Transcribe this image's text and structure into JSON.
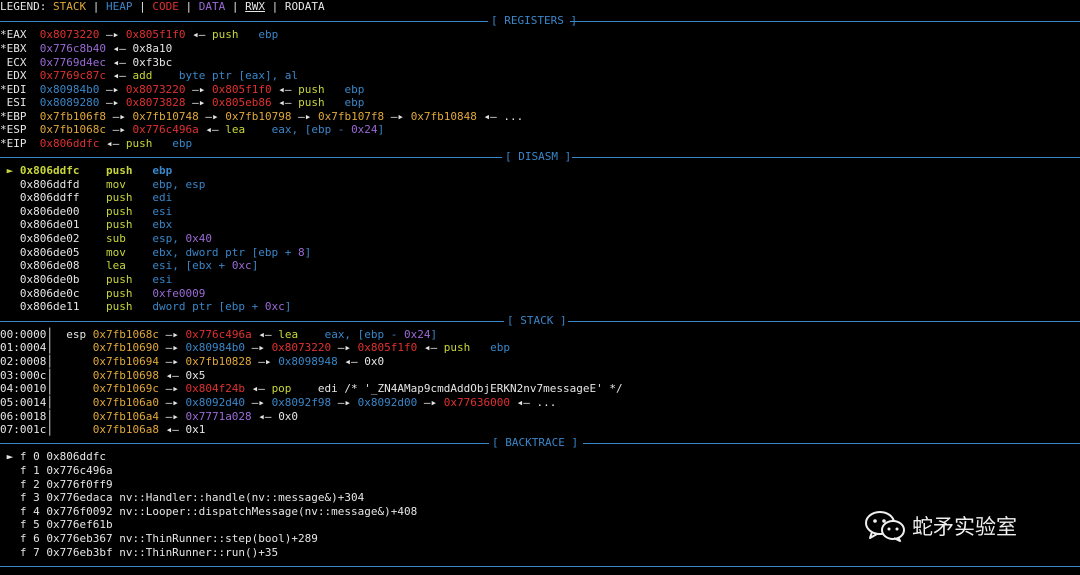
{
  "colors": {
    "stack": "#e0a83a",
    "heap": "#3a86c8",
    "code": "#e03030",
    "data": "#9a6ad6",
    "plain": "#e6e6e6",
    "asm": "#c8d63a",
    "sep": "#3a86c8",
    "arrow": "#e6e6e6"
  },
  "sections": {
    "registers": "[ REGISTERS ]",
    "disasm": "[ DISASM ]",
    "stack": "[ STACK ]",
    "backtrace": "[ BACKTRACE ]"
  },
  "watermark": "蛇矛实验室",
  "lines": [
    {
      "id": "legend",
      "segs": [
        [
          "LEGEND: ",
          "plain"
        ],
        [
          "STACK",
          "stack"
        ],
        [
          " | ",
          "plain"
        ],
        [
          "HEAP",
          "heap"
        ],
        [
          " | ",
          "plain"
        ],
        [
          "CODE",
          "code"
        ],
        [
          " | ",
          "plain"
        ],
        [
          "DATA",
          "data"
        ],
        [
          " | ",
          "plain"
        ],
        [
          "RWX",
          "plain"
        ],
        [
          " | ",
          "plain"
        ],
        [
          "RODATA",
          "plain"
        ]
      ]
    },
    {
      "id": "reg-eax",
      "segs": [
        [
          "*EAX  ",
          "plain"
        ],
        [
          "0x8073220",
          "code"
        ],
        [
          " —▸ ",
          "arrow"
        ],
        [
          "0x805f1f0",
          "code"
        ],
        [
          " ◂— ",
          "arrow"
        ],
        [
          "push",
          "asm"
        ],
        [
          "   ebp",
          "heap"
        ]
      ]
    },
    {
      "id": "reg-ebx",
      "segs": [
        [
          "*EBX  ",
          "plain"
        ],
        [
          "0x776c8b40",
          "data"
        ],
        [
          " ◂— ",
          "arrow"
        ],
        [
          "0x8a10",
          "plain"
        ]
      ]
    },
    {
      "id": "reg-ecx",
      "segs": [
        [
          " ECX  ",
          "plain"
        ],
        [
          "0x7769d4ec",
          "data"
        ],
        [
          " ◂— ",
          "arrow"
        ],
        [
          "0xf3bc",
          "plain"
        ]
      ]
    },
    {
      "id": "reg-edx",
      "segs": [
        [
          " EDX  ",
          "plain"
        ],
        [
          "0x7769c87c",
          "code"
        ],
        [
          " ◂— ",
          "arrow"
        ],
        [
          "add",
          "asm"
        ],
        [
          "    byte ptr [eax], al",
          "heap"
        ]
      ]
    },
    {
      "id": "reg-edi",
      "segs": [
        [
          "*EDI  ",
          "plain"
        ],
        [
          "0x80984b0",
          "heap"
        ],
        [
          " —▸ ",
          "arrow"
        ],
        [
          "0x8073220",
          "code"
        ],
        [
          " —▸ ",
          "arrow"
        ],
        [
          "0x805f1f0",
          "code"
        ],
        [
          " ◂— ",
          "arrow"
        ],
        [
          "push",
          "asm"
        ],
        [
          "   ebp",
          "heap"
        ]
      ]
    },
    {
      "id": "reg-esi",
      "segs": [
        [
          " ESI  ",
          "plain"
        ],
        [
          "0x8089280",
          "heap"
        ],
        [
          " —▸ ",
          "arrow"
        ],
        [
          "0x8073828",
          "code"
        ],
        [
          " —▸ ",
          "arrow"
        ],
        [
          "0x805eb86",
          "code"
        ],
        [
          " ◂— ",
          "arrow"
        ],
        [
          "push",
          "asm"
        ],
        [
          "   ebp",
          "heap"
        ]
      ]
    },
    {
      "id": "reg-ebp",
      "segs": [
        [
          "*EBP  ",
          "plain"
        ],
        [
          "0x7fb106f8",
          "stack"
        ],
        [
          " —▸ ",
          "arrow"
        ],
        [
          "0x7fb10748",
          "stack"
        ],
        [
          " —▸ ",
          "arrow"
        ],
        [
          "0x7fb10798",
          "stack"
        ],
        [
          " —▸ ",
          "arrow"
        ],
        [
          "0x7fb107f8",
          "stack"
        ],
        [
          " —▸ ",
          "arrow"
        ],
        [
          "0x7fb10848",
          "stack"
        ],
        [
          " ◂— ...",
          "arrow"
        ]
      ]
    },
    {
      "id": "reg-esp",
      "segs": [
        [
          "*ESP  ",
          "plain"
        ],
        [
          "0x7fb1068c",
          "stack"
        ],
        [
          " —▸ ",
          "arrow"
        ],
        [
          "0x776c496a",
          "code"
        ],
        [
          " ◂— ",
          "arrow"
        ],
        [
          "lea",
          "asm"
        ],
        [
          "    eax, [ebp - ",
          "heap"
        ],
        [
          "0x24",
          "data"
        ],
        [
          "]",
          "heap"
        ]
      ]
    },
    {
      "id": "reg-eip",
      "segs": [
        [
          "*EIP  ",
          "plain"
        ],
        [
          "0x806ddfc",
          "code"
        ],
        [
          " ◂— ",
          "arrow"
        ],
        [
          "push",
          "asm"
        ],
        [
          "   ebp",
          "heap"
        ]
      ]
    },
    {
      "id": "dis-0",
      "segs": [
        [
          " ► ",
          "asm"
        ],
        [
          "0x806ddfc",
          "asm"
        ],
        [
          "    push",
          "asm"
        ],
        [
          "   ebp",
          "heap"
        ]
      ]
    },
    {
      "id": "dis-1",
      "segs": [
        [
          "   0x806ddfd",
          "plain"
        ],
        [
          "    mov",
          "asm"
        ],
        [
          "    ebp, esp",
          "heap"
        ]
      ]
    },
    {
      "id": "dis-2",
      "segs": [
        [
          "   0x806ddff",
          "plain"
        ],
        [
          "    push",
          "asm"
        ],
        [
          "   edi",
          "heap"
        ]
      ]
    },
    {
      "id": "dis-3",
      "segs": [
        [
          "   0x806de00",
          "plain"
        ],
        [
          "    push",
          "asm"
        ],
        [
          "   esi",
          "heap"
        ]
      ]
    },
    {
      "id": "dis-4",
      "segs": [
        [
          "   0x806de01",
          "plain"
        ],
        [
          "    push",
          "asm"
        ],
        [
          "   ebx",
          "heap"
        ]
      ]
    },
    {
      "id": "dis-5",
      "segs": [
        [
          "   0x806de02",
          "plain"
        ],
        [
          "    sub",
          "asm"
        ],
        [
          "    esp, ",
          "heap"
        ],
        [
          "0x40",
          "data"
        ]
      ]
    },
    {
      "id": "dis-6",
      "segs": [
        [
          "   0x806de05",
          "plain"
        ],
        [
          "    mov",
          "asm"
        ],
        [
          "    ebx, dword ptr [ebp + ",
          "heap"
        ],
        [
          "8",
          "data"
        ],
        [
          "]",
          "heap"
        ]
      ]
    },
    {
      "id": "dis-7",
      "segs": [
        [
          "   0x806de08",
          "plain"
        ],
        [
          "    lea",
          "asm"
        ],
        [
          "    esi, [ebx + ",
          "heap"
        ],
        [
          "0xc",
          "data"
        ],
        [
          "]",
          "heap"
        ]
      ]
    },
    {
      "id": "dis-8",
      "segs": [
        [
          "   0x806de0b",
          "plain"
        ],
        [
          "    push",
          "asm"
        ],
        [
          "   esi",
          "heap"
        ]
      ]
    },
    {
      "id": "dis-9",
      "segs": [
        [
          "   0x806de0c",
          "plain"
        ],
        [
          "    push",
          "asm"
        ],
        [
          "   ",
          "heap"
        ],
        [
          "0xfe0009",
          "data"
        ]
      ]
    },
    {
      "id": "dis-10",
      "segs": [
        [
          "   0x806de11",
          "plain"
        ],
        [
          "    push",
          "asm"
        ],
        [
          "   dword ptr [ebp + ",
          "heap"
        ],
        [
          "0xc",
          "data"
        ],
        [
          "]",
          "heap"
        ]
      ]
    },
    {
      "id": "stk-0",
      "segs": [
        [
          "00:0000│  ",
          "plain"
        ],
        [
          "esp ",
          "plain"
        ],
        [
          "0x7fb1068c",
          "stack"
        ],
        [
          " —▸ ",
          "arrow"
        ],
        [
          "0x776c496a",
          "code"
        ],
        [
          " ◂— ",
          "arrow"
        ],
        [
          "lea",
          "asm"
        ],
        [
          "    eax, [ebp - ",
          "heap"
        ],
        [
          "0x24",
          "data"
        ],
        [
          "]",
          "heap"
        ]
      ]
    },
    {
      "id": "stk-1",
      "segs": [
        [
          "01:0004│      ",
          "plain"
        ],
        [
          "0x7fb10690",
          "stack"
        ],
        [
          " —▸ ",
          "arrow"
        ],
        [
          "0x80984b0",
          "heap"
        ],
        [
          " —▸ ",
          "arrow"
        ],
        [
          "0x8073220",
          "code"
        ],
        [
          " —▸ ",
          "arrow"
        ],
        [
          "0x805f1f0",
          "code"
        ],
        [
          " ◂— ",
          "arrow"
        ],
        [
          "push",
          "asm"
        ],
        [
          "   ebp",
          "heap"
        ]
      ]
    },
    {
      "id": "stk-2",
      "segs": [
        [
          "02:0008│      ",
          "plain"
        ],
        [
          "0x7fb10694",
          "stack"
        ],
        [
          " —▸ ",
          "arrow"
        ],
        [
          "0x7fb10828",
          "stack"
        ],
        [
          " —▸ ",
          "arrow"
        ],
        [
          "0x8098948",
          "heap"
        ],
        [
          " ◂— ",
          "arrow"
        ],
        [
          "0x0",
          "plain"
        ]
      ]
    },
    {
      "id": "stk-3",
      "segs": [
        [
          "03:000c│      ",
          "plain"
        ],
        [
          "0x7fb10698",
          "stack"
        ],
        [
          " ◂— ",
          "arrow"
        ],
        [
          "0x5",
          "plain"
        ]
      ]
    },
    {
      "id": "stk-4",
      "segs": [
        [
          "04:0010│      ",
          "plain"
        ],
        [
          "0x7fb1069c",
          "stack"
        ],
        [
          " —▸ ",
          "arrow"
        ],
        [
          "0x804f24b",
          "code"
        ],
        [
          " ◂— ",
          "arrow"
        ],
        [
          "pop",
          "asm"
        ],
        [
          "    edi /* '_ZN4AMap9cmdAddObjERKN2nv7messageE' */",
          "plain"
        ]
      ]
    },
    {
      "id": "stk-5",
      "segs": [
        [
          "05:0014│      ",
          "plain"
        ],
        [
          "0x7fb106a0",
          "stack"
        ],
        [
          " —▸ ",
          "arrow"
        ],
        [
          "0x8092d40",
          "heap"
        ],
        [
          " —▸ ",
          "arrow"
        ],
        [
          "0x8092f98",
          "heap"
        ],
        [
          " —▸ ",
          "arrow"
        ],
        [
          "0x8092d00",
          "heap"
        ],
        [
          " —▸ ",
          "arrow"
        ],
        [
          "0x77636000",
          "code"
        ],
        [
          " ◂— ...",
          "arrow"
        ]
      ]
    },
    {
      "id": "stk-6",
      "segs": [
        [
          "06:0018│      ",
          "plain"
        ],
        [
          "0x7fb106a4",
          "stack"
        ],
        [
          " —▸ ",
          "arrow"
        ],
        [
          "0x7771a028",
          "data"
        ],
        [
          " ◂— ",
          "arrow"
        ],
        [
          "0x0",
          "plain"
        ]
      ]
    },
    {
      "id": "stk-7",
      "segs": [
        [
          "07:001c│      ",
          "plain"
        ],
        [
          "0x7fb106a8",
          "stack"
        ],
        [
          " ◂— ",
          "arrow"
        ],
        [
          "0x1",
          "plain"
        ]
      ]
    },
    {
      "id": "bt-0",
      "segs": [
        [
          " ► f 0 0x806ddfc",
          "plain"
        ]
      ]
    },
    {
      "id": "bt-1",
      "segs": [
        [
          "   f 1 0x776c496a",
          "plain"
        ]
      ]
    },
    {
      "id": "bt-2",
      "segs": [
        [
          "   f 2 0x776f0ff9",
          "plain"
        ]
      ]
    },
    {
      "id": "bt-3",
      "segs": [
        [
          "   f 3 0x776edaca nv::Handler::handle(nv::message&)+304",
          "plain"
        ]
      ]
    },
    {
      "id": "bt-4",
      "segs": [
        [
          "   f 4 0x776f0092 nv::Looper::dispatchMessage(nv::message&)+408",
          "plain"
        ]
      ]
    },
    {
      "id": "bt-5",
      "segs": [
        [
          "   f 5 0x776ef61b",
          "plain"
        ]
      ]
    },
    {
      "id": "bt-6",
      "segs": [
        [
          "   f 6 0x776eb367 nv::ThinRunner::step(bool)+289",
          "plain"
        ]
      ]
    },
    {
      "id": "bt-7",
      "segs": [
        [
          "   f 7 0x776eb3bf nv::ThinRunner::run()+35",
          "plain"
        ]
      ]
    }
  ]
}
